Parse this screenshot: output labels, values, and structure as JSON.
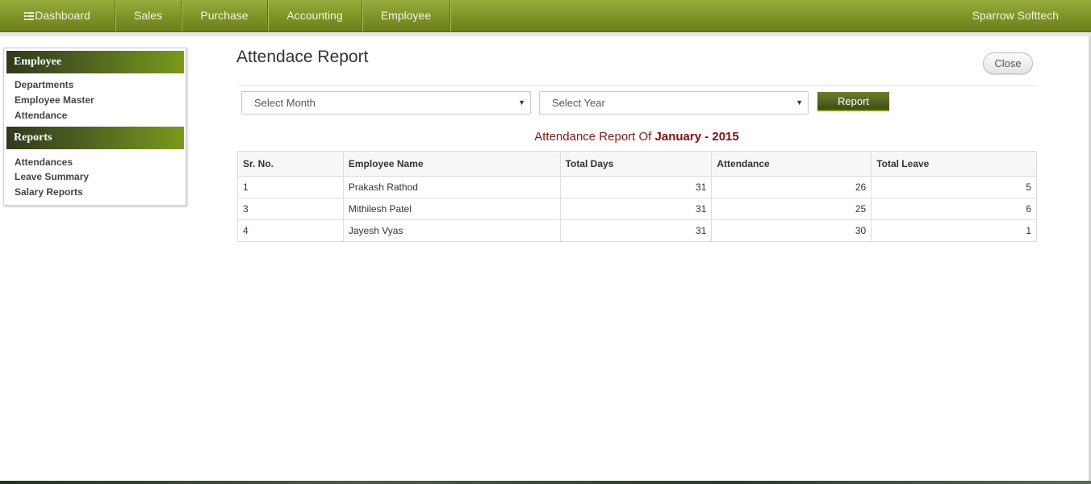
{
  "nav": {
    "items": [
      {
        "label": "Dashboard",
        "icon": "grid-icon"
      },
      {
        "label": "Sales"
      },
      {
        "label": "Purchase"
      },
      {
        "label": "Accounting"
      },
      {
        "label": "Employee"
      }
    ],
    "brand": "Sparrow Softtech"
  },
  "sidebar": {
    "sections": [
      {
        "title": "Employee",
        "links": [
          "Departments",
          "Employee Master",
          "Attendance"
        ]
      },
      {
        "title": "Reports",
        "links": [
          "Attendances",
          "Leave Summary",
          "Salary Reports"
        ]
      }
    ]
  },
  "page": {
    "title": "Attendace Report",
    "close_label": "Close"
  },
  "filters": {
    "month": {
      "value": "Select Month"
    },
    "year": {
      "value": "Select Year"
    },
    "report_label": "Report"
  },
  "report": {
    "heading_prefix": "Attendance Report Of",
    "heading_period": "January - 2015",
    "columns": [
      "Sr. No.",
      "Employee Name",
      "Total Days",
      "Attendance",
      "Total Leave"
    ],
    "rows": [
      {
        "sr": "1",
        "name": "Prakash Rathod",
        "total_days": "31",
        "attendance": "26",
        "total_leave": "5"
      },
      {
        "sr": "3",
        "name": "Mithilesh Patel",
        "total_days": "31",
        "attendance": "25",
        "total_leave": "6"
      },
      {
        "sr": "4",
        "name": "Jayesh Vyas",
        "total_days": "31",
        "attendance": "30",
        "total_leave": "1"
      }
    ]
  },
  "colors": {
    "nav_green": "#7f9527",
    "sidebar_header": "#4f6221",
    "heading_maroon": "#7a1a1a"
  }
}
